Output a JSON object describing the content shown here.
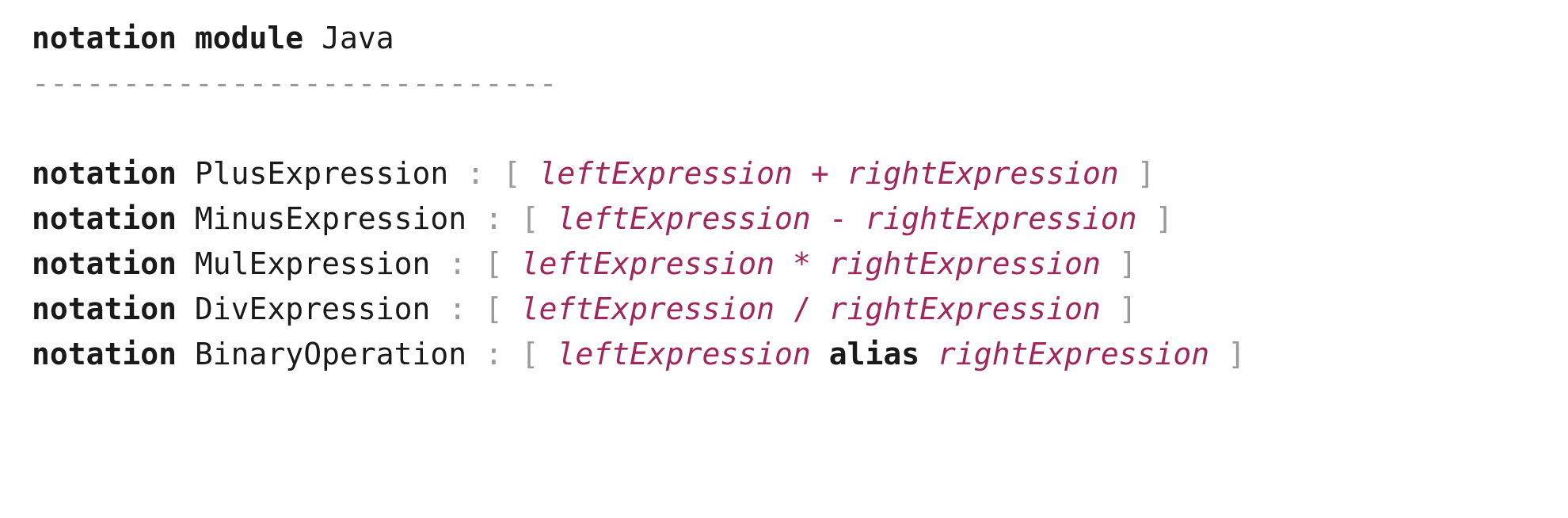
{
  "header": {
    "kw_notation": "notation",
    "kw_module": "module",
    "module_name": "Java",
    "divider": "-----------------------------"
  },
  "notations": [
    {
      "kw": "notation",
      "name": "PlusExpression",
      "colon": " : ",
      "open": "[",
      "left": "leftExpression",
      "operator": "+",
      "operator_is_keyword": false,
      "right": "rightExpression",
      "close": "]"
    },
    {
      "kw": "notation",
      "name": "MinusExpression",
      "colon": " : ",
      "open": "[",
      "left": "leftExpression",
      "operator": "-",
      "operator_is_keyword": false,
      "right": "rightExpression",
      "close": "]"
    },
    {
      "kw": "notation",
      "name": "MulExpression",
      "colon": " : ",
      "open": "[",
      "left": "leftExpression",
      "operator": "*",
      "operator_is_keyword": false,
      "right": "rightExpression",
      "close": "]"
    },
    {
      "kw": "notation",
      "name": "DivExpression",
      "colon": " : ",
      "open": "[",
      "left": "leftExpression",
      "operator": "/",
      "operator_is_keyword": false,
      "right": "rightExpression",
      "close": "]"
    },
    {
      "kw": "notation",
      "name": "BinaryOperation",
      "colon": " : ",
      "open": "[",
      "left": "leftExpression",
      "operator": "alias",
      "operator_is_keyword": true,
      "right": "rightExpression",
      "close": "]"
    }
  ]
}
